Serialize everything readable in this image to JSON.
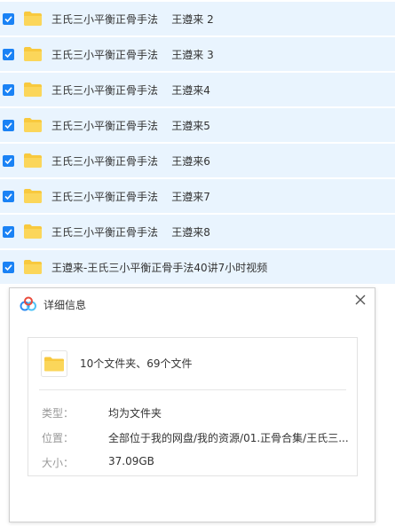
{
  "files": [
    {
      "name": "王氏三小平衡正骨手法    王遵来 2",
      "checked": true
    },
    {
      "name": "王氏三小平衡正骨手法    王遵来 3",
      "checked": true
    },
    {
      "name": "王氏三小平衡正骨手法    王遵来4",
      "checked": true
    },
    {
      "name": "王氏三小平衡正骨手法    王遵来5",
      "checked": true
    },
    {
      "name": "王氏三小平衡正骨手法    王遵来6",
      "checked": true
    },
    {
      "name": "王氏三小平衡正骨手法    王遵来7",
      "checked": true
    },
    {
      "name": "王氏三小平衡正骨手法    王遵来8",
      "checked": true
    },
    {
      "name": "王遵来-王氏三小平衡正骨手法40讲7小时视频",
      "checked": true
    }
  ],
  "dialog": {
    "title": "详细信息",
    "summary": "10个文件夹、69个文件",
    "info": [
      {
        "label": "类型：",
        "value": "均为文件夹"
      },
      {
        "label": "位置：",
        "value": "全部位于我的网盘/我的资源/01.正骨合集/王氏三..."
      },
      {
        "label": "大小：",
        "value": "37.09GB"
      }
    ]
  },
  "colors": {
    "row_bg": "#e9f4fe",
    "checkbox": "#1a82f5",
    "folder": "#f8c93e"
  }
}
